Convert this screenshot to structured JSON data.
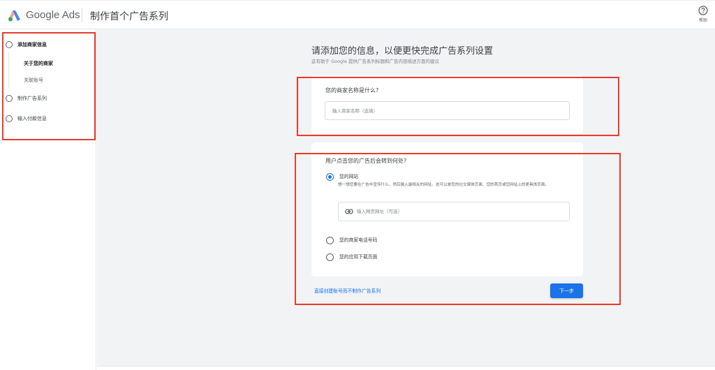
{
  "header": {
    "brand": "Google Ads",
    "title": "制作首个广告系列",
    "help_label": "帮助"
  },
  "sidebar": {
    "steps": [
      {
        "label": "添加商家信息",
        "substeps": [
          {
            "label": "关于您的商家",
            "active": true
          },
          {
            "label": "关联账号",
            "active": false
          }
        ]
      },
      {
        "label": "制作广告系列"
      },
      {
        "label": "输入付款信息"
      }
    ]
  },
  "main": {
    "title": "请添加您的信息，以便更快完成广告系列设置",
    "subtitle": "这有助于 Google 提供广告系列标题和广告内容描述方面的建议",
    "business_card": {
      "question": "您的商家名称是什么?",
      "input_value": "",
      "input_placeholder": "输入商家名称（选填）"
    },
    "destination_card": {
      "question": "用户点击您的广告后会转到何处?",
      "options": [
        {
          "label": "您的网站",
          "selected": true,
          "description": "想一想您要在广告中宣传什么，然后输入最相关的网址。这可以是您的社交媒体页面、您的首页或您网站上的更具体页面。"
        },
        {
          "label": "您的商家电话号码",
          "selected": false
        },
        {
          "label": "您的应用下载页面",
          "selected": false
        }
      ],
      "url_input_value": "",
      "url_input_placeholder": "输入网页网址（可选）",
      "url_icon": "link-icon"
    },
    "skip_link": "直接创建账号而不制作广告系列",
    "next_button": "下一步"
  },
  "colors": {
    "accent": "#1a73e8",
    "annotation": "#ea3b2c",
    "background": "#f1f3f4"
  }
}
